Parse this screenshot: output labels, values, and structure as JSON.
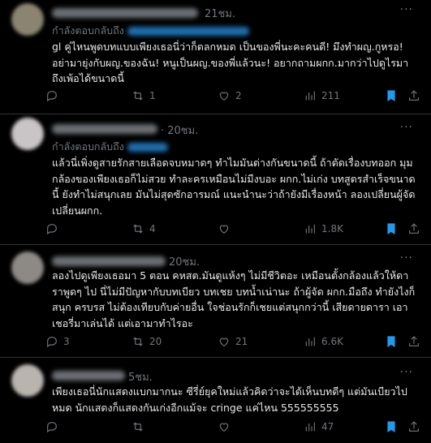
{
  "tweets": [
    {
      "time": "21ชม.",
      "reply_prefix": "กำลังตอบกลับถึง",
      "text": "gl คู่ไหนพูดบทแบบเพียงเธอนี่ว่าก็ตลกหมด เป็นของพี่นะคะคนดี! มึงทำผญ.กูหรอ!\nอย่ามายุ่งกับผญ.ของฉัน! หนูเป็นผญ.ของพี่แล้วนะ! อยากถามผกก.มากว่าไปดูไรมาถึงเพ้อได้ขนาดนี้",
      "replies": "",
      "reposts": "1",
      "likes": "2",
      "views": "211",
      "avatar_color": "#8a8470"
    },
    {
      "time": "· 20ชม.",
      "reply_prefix": "กำลังตอบกลับถึง",
      "text": "แล้วนี่เพิ่งดูสายรักสายเลือดจบหมาดๆ ทำไมมันต่างกันขนาดนี้ ถ้าตัดเรื่องบทออก มุมกล้องของเพียงเธอก็ไม่สวย ทำละครเหมือนไม่มีงบอะ ผกก.ไม่เก่ง บทสูตรสำเร็จขนาดนี้ ยังทำไม่สนุกเลย มันไม่สุดซักอารมณ์ แนะนำนะว่าถ้ายังมีเรื่องหน้า ลองเปลี่ยนผู้จัด เปลี่ยนผกก.",
      "replies": "",
      "reposts": "4",
      "likes": "",
      "views": "1.8K",
      "avatar_color": "#c9c4c6"
    },
    {
      "time": "20ชม.",
      "reply_prefix": "",
      "text": "ลองไปดูเพียงเธอมา 5 ตอน คหสต.มันดูแห้งๆ ไม่มีชีวิตอะ เหมือนตั้งกล้องแล้วให้ดาราพูดๆ ไป นี่ไม่มีปัญหากับบทเบียว บทเชย บทน้ำเน่านะ ถ้าผู้จัด ผกก.มือถึง ทำยังไงก็สนุก ครบรส ไม่ต้องเทียบกับค่ายอื่น ใจช่อนรักก็เชยแต่สนุกกว่านี้ เสียดายดารา เอาเชอรี่มาเล่นได้ แต่เอามาทำไรอะ",
      "replies": "3",
      "reposts": "20",
      "likes": "21",
      "views": "6.6K",
      "avatar_color": "#8d8a86"
    },
    {
      "time": "5ชม.",
      "reply_prefix": "",
      "text": "เพียงเธอนี่นักแสดงแบกมากนะ ซีรี่ย์ยุคใหม่แล้วคิดว่าจะได้เห็นบทดีๆ แต่มันเบียวไปหมด นักแสดงก็แสดงกันเก่งอีกแม้จะ cringe แค่ไหน 555555555",
      "replies": "",
      "reposts": "",
      "likes": "",
      "views": "47",
      "avatar_color": "#b9b4ae"
    }
  ],
  "more_icon": "more-horizontal-icon",
  "colors": {
    "accent": "#1d9bf0",
    "muted": "#71767b",
    "text": "#e7e9ea",
    "bg": "#000000"
  }
}
